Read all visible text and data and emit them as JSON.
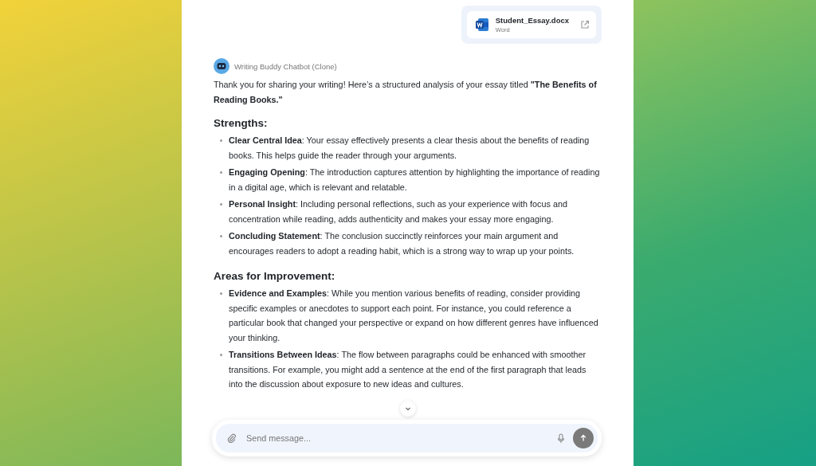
{
  "attachment": {
    "file_name": "Student_Essay.docx",
    "file_type": "Word"
  },
  "bot": {
    "name": "Writing Buddy Chatbot (Clone)"
  },
  "message": {
    "intro": "Thank you for sharing your writing! Here’s a structured analysis of your essay titled **\"The Benefits of Reading Books.\"**",
    "sections": [
      {
        "heading": "Strengths:",
        "items": [
          "**Clear Central Idea**: Your essay effectively presents a clear thesis about the benefits of reading books. This helps guide the reader through your arguments.",
          "**Engaging Opening**: The introduction captures attention by highlighting the importance of reading in a digital age, which is relevant and relatable.",
          "**Personal Insight**: Including personal reflections, such as your experience with focus and concentration while reading, adds authenticity and makes your essay more engaging.",
          "**Concluding Statement**: The conclusion succinctly reinforces your main argument and encourages readers to adopt a reading habit, which is a strong way to wrap up your points."
        ]
      },
      {
        "heading": "Areas for Improvement:",
        "items": [
          "**Evidence and Examples**: While you mention various benefits of reading, consider providing specific examples or anecdotes to support each point. For instance, you could reference a particular book that changed your perspective or expand on how different genres have influenced your thinking.",
          "**Transitions Between Ideas**: The flow between paragraphs could be enhanced with smoother transitions. For example, you might add a sentence at the end of the first paragraph that leads into the discussion about exposure to new ideas and cultures."
        ]
      }
    ]
  },
  "composer": {
    "placeholder": "Send message..."
  }
}
